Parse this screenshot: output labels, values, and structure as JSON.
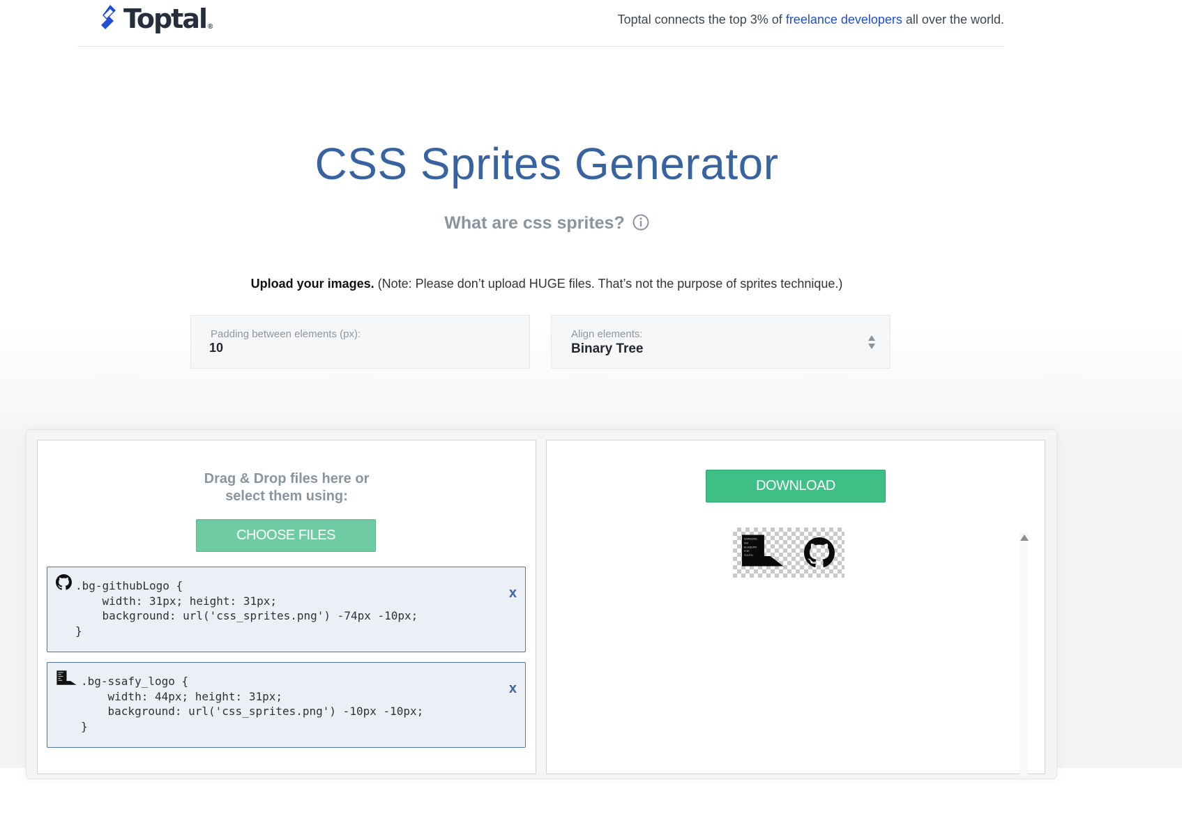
{
  "header": {
    "logo_text": "Toptal",
    "logo_reg": "®",
    "tagline_pre": "Toptal connects the top 3% of ",
    "tagline_link": "freelance developers",
    "tagline_post": " all over the world."
  },
  "page": {
    "title": "CSS Sprites Generator",
    "subtitle": "What are css sprites?",
    "upload_bold": "Upload your images.",
    "upload_note": " (Note: Please don’t upload HUGE files. That’s not the purpose of sprites technique.)"
  },
  "options": {
    "padding_label": "Padding between elements (px):",
    "padding_value": "10",
    "align_label": "Align elements:",
    "align_value": "Binary Tree"
  },
  "left_panel": {
    "drop_line1": "Drag & Drop files here or",
    "drop_line2": "select them using:",
    "choose_label": "CHOOSE FILES"
  },
  "css_items": [
    {
      "code": ".bg-githubLogo {\n    width: 31px; height: 31px;\n    background: url('css_sprites.png') -74px -10px;\n}",
      "remove": "x",
      "thumb_icon": "github-icon"
    },
    {
      "code": ".bg-ssafy_logo {\n    width: 44px; height: 31px;\n    background: url('css_sprites.png') -10px -10px;\n}",
      "remove": "x",
      "thumb_icon": "ssafy-logo-icon"
    }
  ],
  "right_panel": {
    "download_label": "DOWNLOAD",
    "ssafy_logo_lines": [
      "SAMSUNG",
      "SW",
      "ACADEMY",
      "FOR",
      "YOUTH"
    ]
  },
  "colors": {
    "title": "#3863a0",
    "link": "#204ecf",
    "choose_button": "#6fcba3",
    "download_button": "#3ebf86",
    "item_border": "#4e74b0",
    "item_bg": "#ebeff6"
  }
}
